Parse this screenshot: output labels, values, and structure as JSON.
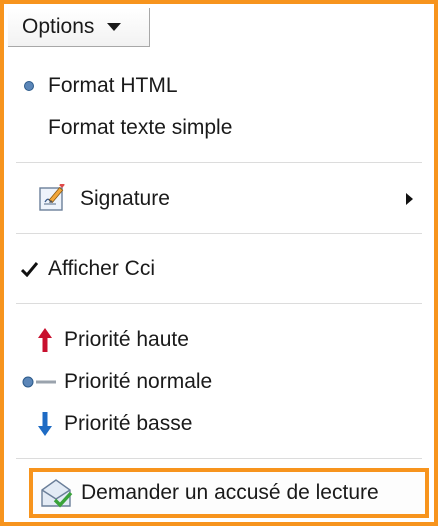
{
  "toolbar": {
    "options_label": "Options"
  },
  "menu": {
    "format_html": "Format HTML",
    "format_text": "Format texte simple",
    "signature": "Signature",
    "show_bcc": "Afficher Cci",
    "priority_high": "Priorité haute",
    "priority_normal": "Priorité normale",
    "priority_low": "Priorité basse",
    "read_receipt": "Demander un accusé de lecture"
  },
  "icons": {
    "format_html": "radio-dot-icon",
    "signature": "signature-pen-icon",
    "show_bcc": "checkmark-icon",
    "priority_high": "arrow-up-icon",
    "priority_normal": "normal-priority-icon",
    "priority_low": "arrow-down-icon",
    "read_receipt": "envelope-check-icon"
  },
  "colors": {
    "highlight_border": "#f7941d",
    "priority_high": "#c8102e",
    "priority_low": "#1e6bc4",
    "radio_dot": "#5b86b8"
  }
}
